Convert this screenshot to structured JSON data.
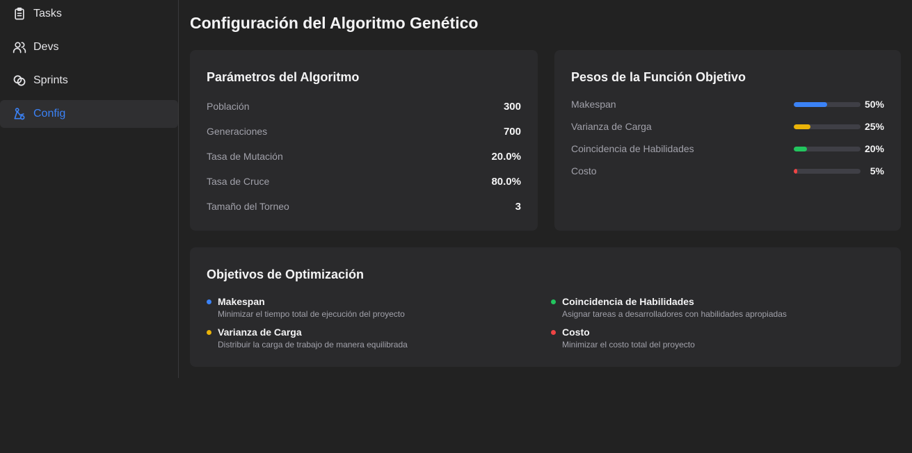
{
  "sidebar": {
    "items": [
      {
        "label": "Tasks",
        "icon": "clipboard-icon",
        "active": false
      },
      {
        "label": "Devs",
        "icon": "users-icon",
        "active": false
      },
      {
        "label": "Sprints",
        "icon": "link-rings-icon",
        "active": false
      },
      {
        "label": "Config",
        "icon": "config-icon",
        "active": true
      }
    ]
  },
  "page_title": "Configuración del Algoritmo Genético",
  "parameters": {
    "title": "Parámetros del Algoritmo",
    "rows": [
      {
        "label": "Población",
        "value": "300"
      },
      {
        "label": "Generaciones",
        "value": "700"
      },
      {
        "label": "Tasa de Mutación",
        "value": "20.0%"
      },
      {
        "label": "Tasa de Cruce",
        "value": "80.0%"
      },
      {
        "label": "Tamaño del Torneo",
        "value": "3"
      }
    ]
  },
  "weights": {
    "title": "Pesos de la Función Objetivo",
    "rows": [
      {
        "label": "Makespan",
        "value": "50%",
        "fraction": 0.5,
        "color": "#3b82f6"
      },
      {
        "label": "Varianza de Carga",
        "value": "25%",
        "fraction": 0.25,
        "color": "#eab308"
      },
      {
        "label": "Coincidencia de Habilidades",
        "value": "20%",
        "fraction": 0.2,
        "color": "#22c55e"
      },
      {
        "label": "Costo",
        "value": "5%",
        "fraction": 0.05,
        "color": "#ef4444"
      }
    ]
  },
  "objectives": {
    "title": "Objetivos de Optimización",
    "items": [
      {
        "name": "Makespan",
        "desc": "Minimizar el tiempo total de ejecución del proyecto",
        "color": "#3b82f6"
      },
      {
        "name": "Varianza de Carga",
        "desc": "Distribuir la carga de trabajo de manera equilibrada",
        "color": "#eab308"
      },
      {
        "name": "Coincidencia de Habilidades",
        "desc": "Asignar tareas a desarrolladores con habilidades apropiadas",
        "color": "#22c55e"
      },
      {
        "name": "Costo",
        "desc": "Minimizar el costo total del proyecto",
        "color": "#ef4444"
      }
    ]
  }
}
